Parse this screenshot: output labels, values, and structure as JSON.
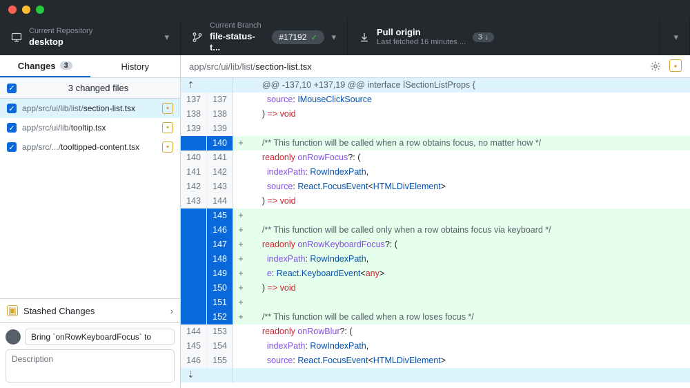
{
  "toolbar": {
    "repo_sub": "Current Repository",
    "repo_name": "desktop",
    "branch_sub": "Current Branch",
    "branch_name": "file-status-t...",
    "pr_pill": "#17192",
    "pull_title": "Pull origin",
    "pull_sub": "Last fetched 16 minutes ...",
    "pull_badge": "3 ↓"
  },
  "tabs": {
    "changes": "Changes",
    "changes_badge": "3",
    "history": "History"
  },
  "files": {
    "header": "3 changed files",
    "items": [
      {
        "dir": "app/src/ui/lib/list/",
        "name": "section-list.tsx",
        "sel": true
      },
      {
        "dir": "app/src/ui/lib/",
        "name": "tooltip.tsx",
        "sel": false
      },
      {
        "dir": "app/src/.../",
        "name": "tooltipped-content.tsx",
        "sel": false
      }
    ]
  },
  "stash": "Stashed Changes",
  "commit": {
    "summary": "Bring `onRowKeyboardFocus` to",
    "desc_ph": "Description"
  },
  "diff": {
    "crumb_dir": "app/src/ui/lib/list/",
    "crumb_file": "section-list.tsx",
    "hunk": "@@ -137,10 +137,19 @@ interface ISectionListProps {",
    "lines": [
      {
        "a": "137",
        "b": "137",
        "m": "",
        "t": "ctx",
        "code": "      source: IMouseClickSource"
      },
      {
        "a": "138",
        "b": "138",
        "m": "",
        "t": "ctx",
        "code": "    ) => void"
      },
      {
        "a": "139",
        "b": "139",
        "m": "",
        "t": "ctx",
        "code": ""
      },
      {
        "a": "",
        "b": "140",
        "m": "+",
        "t": "add",
        "code": "    /** This function will be called when a row obtains focus, no matter how */"
      },
      {
        "a": "140",
        "b": "141",
        "m": "",
        "t": "ctx",
        "code": "    readonly onRowFocus?: ("
      },
      {
        "a": "141",
        "b": "142",
        "m": "",
        "t": "ctx",
        "code": "      indexPath: RowIndexPath,"
      },
      {
        "a": "142",
        "b": "143",
        "m": "",
        "t": "ctx",
        "code": "      source: React.FocusEvent<HTMLDivElement>"
      },
      {
        "a": "143",
        "b": "144",
        "m": "",
        "t": "ctx",
        "code": "    ) => void"
      },
      {
        "a": "",
        "b": "145",
        "m": "+",
        "t": "add",
        "code": ""
      },
      {
        "a": "",
        "b": "146",
        "m": "+",
        "t": "add",
        "code": "    /** This function will be called only when a row obtains focus via keyboard */"
      },
      {
        "a": "",
        "b": "147",
        "m": "+",
        "t": "add",
        "code": "    readonly onRowKeyboardFocus?: ("
      },
      {
        "a": "",
        "b": "148",
        "m": "+",
        "t": "add",
        "code": "      indexPath: RowIndexPath,"
      },
      {
        "a": "",
        "b": "149",
        "m": "+",
        "t": "add",
        "code": "      e: React.KeyboardEvent<any>"
      },
      {
        "a": "",
        "b": "150",
        "m": "+",
        "t": "add",
        "code": "    ) => void"
      },
      {
        "a": "",
        "b": "151",
        "m": "+",
        "t": "add",
        "code": ""
      },
      {
        "a": "",
        "b": "152",
        "m": "+",
        "t": "add",
        "code": "    /** This function will be called when a row loses focus */"
      },
      {
        "a": "144",
        "b": "153",
        "m": "",
        "t": "ctx",
        "code": "    readonly onRowBlur?: ("
      },
      {
        "a": "145",
        "b": "154",
        "m": "",
        "t": "ctx",
        "code": "      indexPath: RowIndexPath,"
      },
      {
        "a": "146",
        "b": "155",
        "m": "",
        "t": "ctx",
        "code": "      source: React.FocusEvent<HTMLDivElement>"
      }
    ]
  }
}
